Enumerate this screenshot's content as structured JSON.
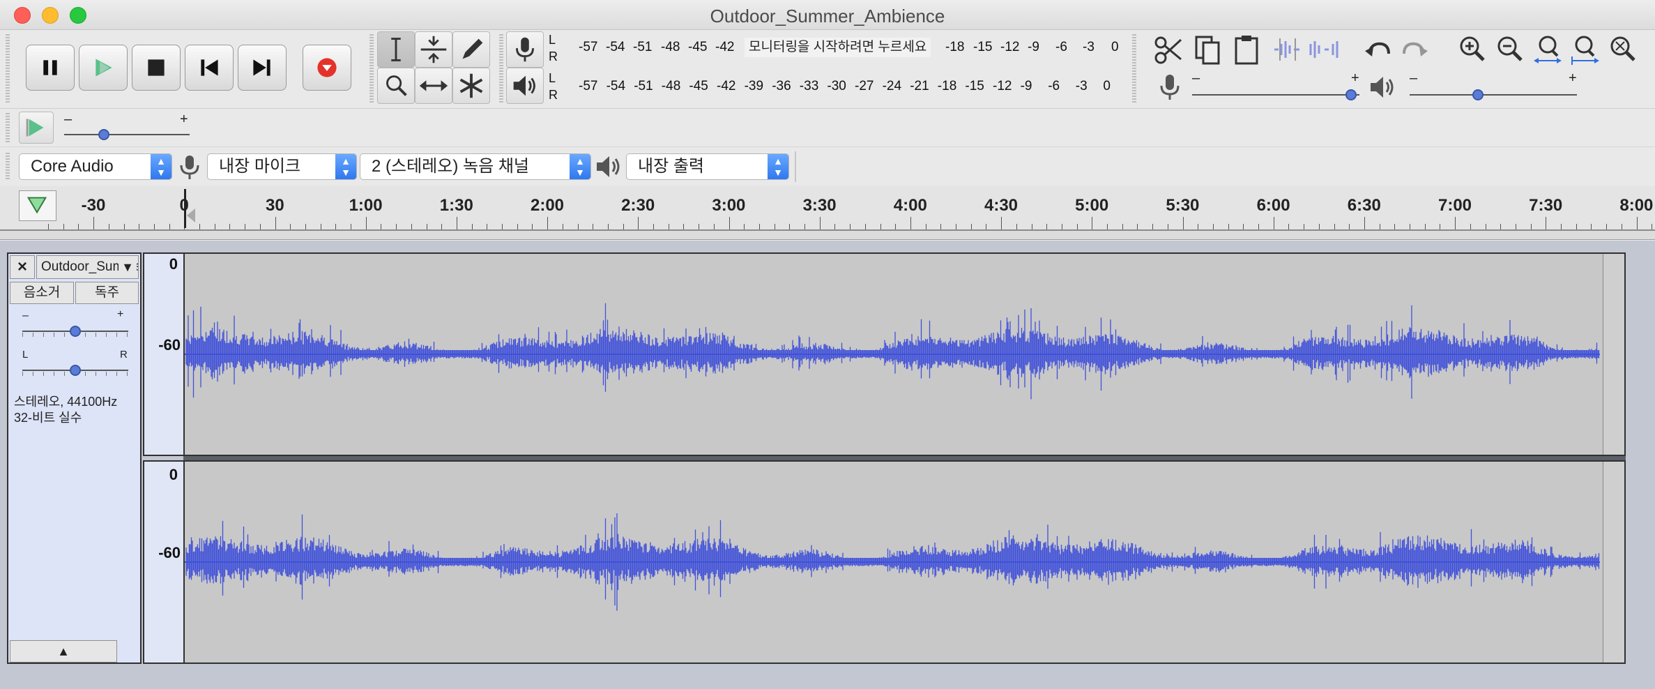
{
  "window": {
    "title": "Outdoor_Summer_Ambience",
    "traffic_lights": [
      "#ff5f57",
      "#febc2e",
      "#28c840"
    ]
  },
  "transport": {
    "buttons": [
      "pause-icon",
      "play-icon",
      "stop-icon",
      "skip-to-start-icon",
      "skip-to-end-icon",
      "record-icon"
    ]
  },
  "tools": [
    "selection-tool-icon",
    "envelope-tool-icon",
    "draw-tool-icon",
    "zoom-tool-icon",
    "timeshift-tool-icon",
    "multi-tool-icon"
  ],
  "meters": {
    "record_ticks": [
      "-57",
      "-54",
      "-51",
      "-48",
      "-45",
      "-42",
      "-18",
      "-15",
      "-12",
      "-9",
      "-6",
      "-3",
      "0"
    ],
    "record_prompt": "모니터링을 시작하려면 누르세요",
    "playback_ticks": [
      "-57",
      "-54",
      "-51",
      "-48",
      "-45",
      "-42",
      "-39",
      "-36",
      "-33",
      "-30",
      "-27",
      "-24",
      "-21",
      "-18",
      "-15",
      "-12",
      "-9",
      "-6",
      "-3",
      "0"
    ],
    "left_label": "L",
    "right_label": "R"
  },
  "edit": {
    "buttons": [
      "cut-icon",
      "copy-icon",
      "paste-icon",
      "trim-icon",
      "silence-icon",
      "undo-icon",
      "redo-icon",
      "zoom-in-icon",
      "zoom-out-icon",
      "fit-selection-icon",
      "fit-project-icon",
      "zoom-toggle-icon"
    ]
  },
  "mixer": {
    "minus": "–",
    "plus": "+",
    "record_volume": 0.98,
    "playback_volume": 0.4
  },
  "play_at_speed": {
    "minus": "–",
    "plus": "+",
    "speed": 0.3
  },
  "devices": {
    "host": "Core Audio",
    "input": "내장 마이크",
    "channels": "2 (스테레오) 녹음 채널",
    "output": "내장 출력"
  },
  "ruler": {
    "labels": [
      "-30",
      "0",
      "30",
      "1:00",
      "1:30",
      "2:00",
      "2:30",
      "3:00",
      "3:30",
      "4:00",
      "4:30",
      "5:00",
      "5:30",
      "6:00",
      "6:30",
      "7:00",
      "7:30",
      "8:00"
    ]
  },
  "track": {
    "close": "×",
    "name": "Outdoor_Summer_Ambience",
    "mute": "음소거",
    "solo": "독주",
    "gain_minus": "–",
    "gain_plus": "+",
    "pan_left": "L",
    "pan_right": "R",
    "format_line1": "스테레오, 44100Hz",
    "format_line2": "32-비트 실수",
    "collapse": "▲",
    "vruler_top": "0",
    "vruler_mid": "-60",
    "waveform_color": "#4051d8"
  }
}
